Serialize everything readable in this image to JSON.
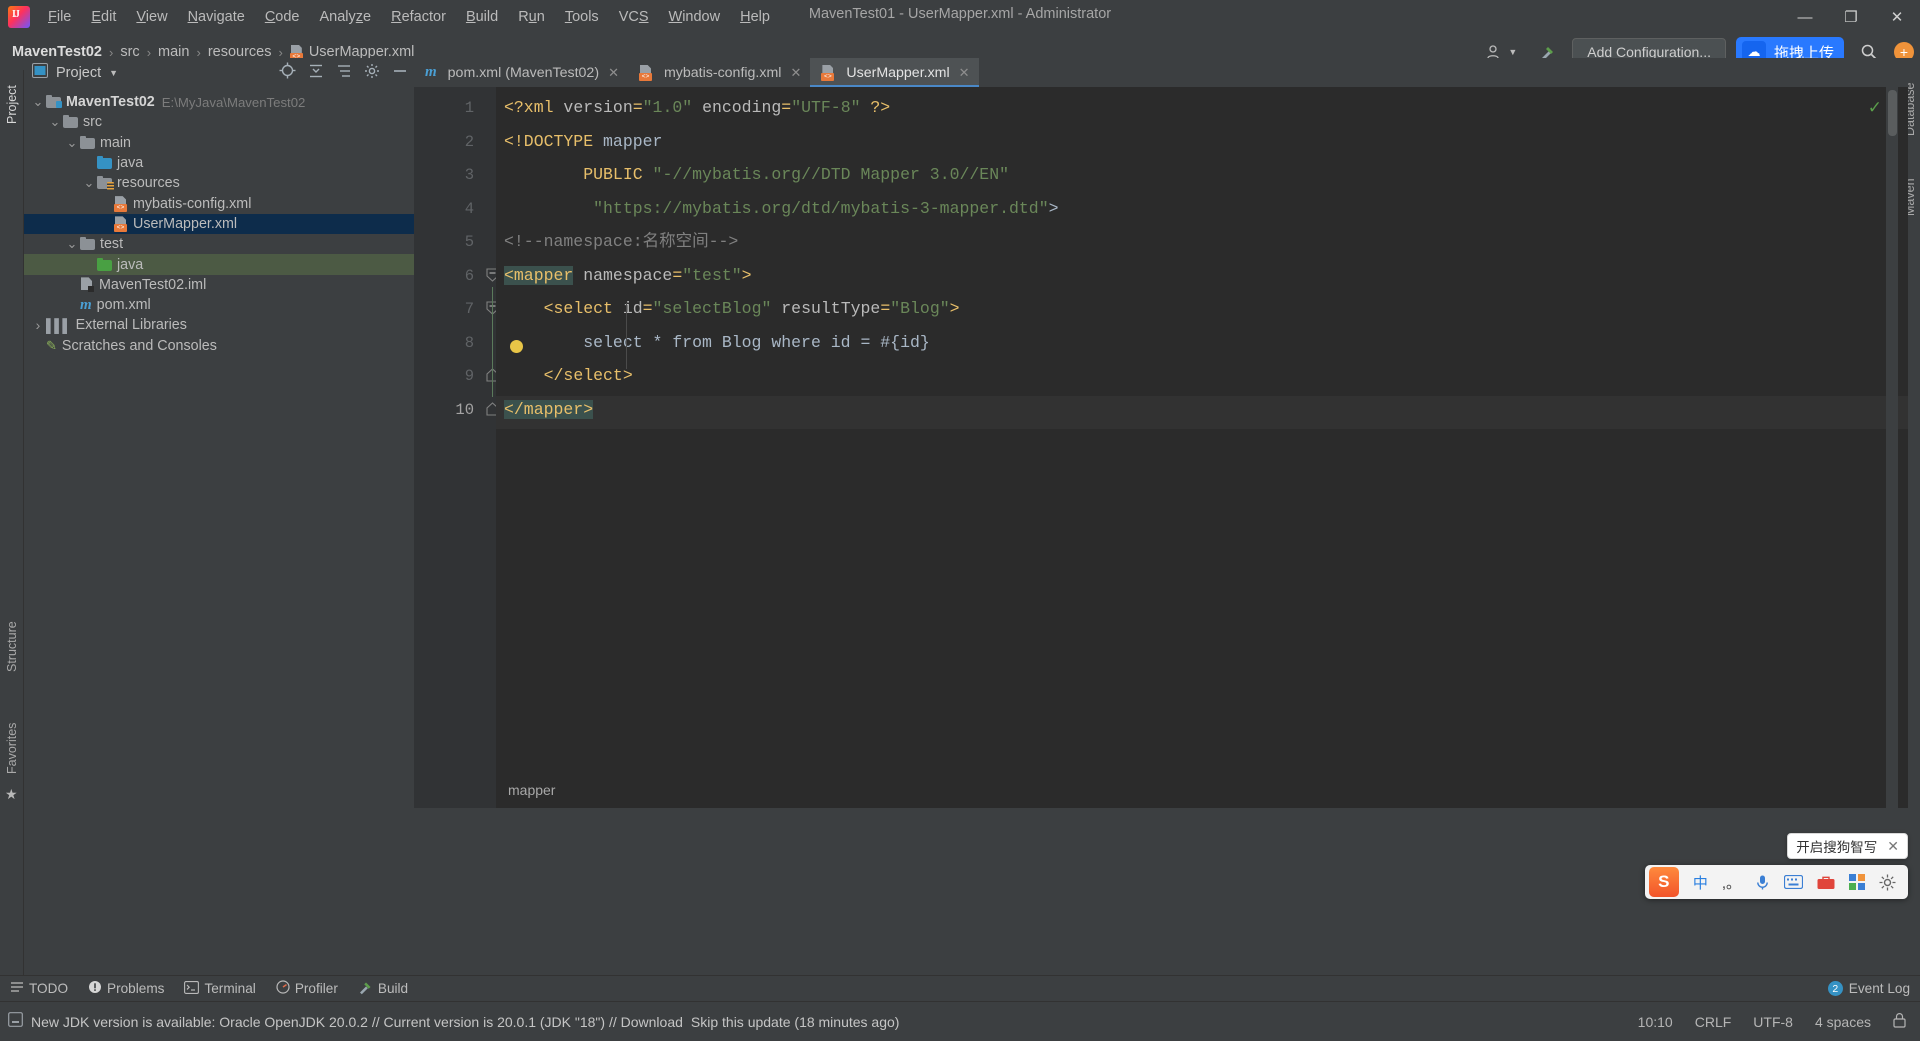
{
  "window": {
    "title": "MavenTest01 - UserMapper.xml - Administrator",
    "minimize": "—",
    "maximize": "❐",
    "close": "✕"
  },
  "menu": {
    "items": [
      {
        "label": "File"
      },
      {
        "label": "Edit"
      },
      {
        "label": "View"
      },
      {
        "label": "Navigate"
      },
      {
        "label": "Code"
      },
      {
        "label": "Analyze"
      },
      {
        "label": "Refactor"
      },
      {
        "label": "Build"
      },
      {
        "label": "Run"
      },
      {
        "label": "Tools"
      },
      {
        "label": "VCS"
      },
      {
        "label": "Window"
      },
      {
        "label": "Help"
      }
    ]
  },
  "breadcrumb": {
    "project": "MavenTest02",
    "parts": [
      "src",
      "main",
      "resources"
    ],
    "file": "UserMapper.xml",
    "separator": "›"
  },
  "navbar_right": {
    "user_icon": "user-icon",
    "hammer_icon": "build-icon",
    "add_configuration": "Add Configuration...",
    "sogou_upload": "拖拽上传",
    "search_icon": "search-icon",
    "plus_icon": "+"
  },
  "left_toolstrip": {
    "project_tab": "Project",
    "structure_tab": "Structure",
    "favorites_tab": "Favorites",
    "star_icon": "★"
  },
  "right_toolstrip": {
    "database_tab": "Database",
    "maven_tab": "Maven"
  },
  "project_panel": {
    "title": "Project",
    "dropdown_icon": "▼",
    "toolbar_icons": [
      "locate-icon",
      "collapse-all-icon",
      "expand-icon",
      "gear-icon",
      "hide-icon"
    ],
    "tree": [
      {
        "label": "MavenTest02",
        "path": "E:\\MyJava\\MavenTest02",
        "indent": 0,
        "arrow": "expanded",
        "icon": "module-folder",
        "bold": true,
        "state": "normal"
      },
      {
        "label": "src",
        "indent": 1,
        "arrow": "expanded",
        "icon": "folder-grey",
        "state": "normal"
      },
      {
        "label": "main",
        "indent": 2,
        "arrow": "expanded",
        "icon": "folder-grey",
        "state": "normal"
      },
      {
        "label": "java",
        "indent": 3,
        "arrow": "none",
        "icon": "folder-blue",
        "state": "normal"
      },
      {
        "label": "resources",
        "indent": 3,
        "arrow": "expanded",
        "icon": "folder-resources",
        "state": "normal"
      },
      {
        "label": "mybatis-config.xml",
        "indent": 4,
        "arrow": "none",
        "icon": "xml-file",
        "state": "normal"
      },
      {
        "label": "UserMapper.xml",
        "indent": 4,
        "arrow": "none",
        "icon": "xml-file",
        "state": "selected"
      },
      {
        "label": "test",
        "indent": 2,
        "arrow": "expanded",
        "icon": "folder-grey",
        "state": "normal"
      },
      {
        "label": "java",
        "indent": 3,
        "arrow": "none",
        "icon": "folder-green",
        "state": "green"
      },
      {
        "label": "MavenTest02.iml",
        "indent": 2,
        "arrow": "none",
        "icon": "iml-file",
        "state": "normal"
      },
      {
        "label": "pom.xml",
        "indent": 2,
        "arrow": "none",
        "icon": "maven-file",
        "state": "normal"
      },
      {
        "label": "External Libraries",
        "indent": 0,
        "arrow": "collapsed",
        "icon": "library-icon",
        "state": "normal"
      },
      {
        "label": "Scratches and Consoles",
        "indent": 0,
        "arrow": "none",
        "icon": "scratch-icon",
        "state": "normal"
      }
    ]
  },
  "editor": {
    "tabs": [
      {
        "label": "pom.xml (MavenTest02)",
        "icon": "maven-file",
        "active": false,
        "close": "✕"
      },
      {
        "label": "mybatis-config.xml",
        "icon": "xml-file",
        "active": false,
        "close": "✕"
      },
      {
        "label": "UserMapper.xml",
        "icon": "xml-file",
        "active": true,
        "close": "✕"
      }
    ],
    "line_numbers": [
      "1",
      "2",
      "3",
      "4",
      "5",
      "6",
      "7",
      "8",
      "9",
      "10"
    ],
    "lines": [
      {
        "n": 1,
        "tokens": [
          {
            "t": "<?xml ",
            "c": "kw-punc"
          },
          {
            "t": "version",
            "c": "kw-attr"
          },
          {
            "t": "=",
            "c": "kw-punc"
          },
          {
            "t": "\"1.0\"",
            "c": "kw-str"
          },
          {
            "t": " ",
            "c": "kw-txt"
          },
          {
            "t": "encoding",
            "c": "kw-attr"
          },
          {
            "t": "=",
            "c": "kw-punc"
          },
          {
            "t": "\"UTF-8\"",
            "c": "kw-str"
          },
          {
            "t": " ",
            "c": "kw-txt"
          },
          {
            "t": "?>",
            "c": "kw-punc"
          }
        ]
      },
      {
        "n": 2,
        "tokens": [
          {
            "t": "<!DOCTYPE",
            "c": "kw-tag"
          },
          {
            "t": " mapper",
            "c": "kw-txt"
          }
        ]
      },
      {
        "n": 3,
        "tokens": [
          {
            "t": "        ",
            "c": "kw-txt"
          },
          {
            "t": "PUBLIC",
            "c": "kw-tag"
          },
          {
            "t": " ",
            "c": "kw-txt"
          },
          {
            "t": "\"-//mybatis.org//DTD Mapper 3.0//EN\"",
            "c": "kw-str"
          }
        ]
      },
      {
        "n": 4,
        "tokens": [
          {
            "t": "         ",
            "c": "kw-txt"
          },
          {
            "t": "\"https://mybatis.org/dtd/mybatis-3-mapper.dtd\"",
            "c": "kw-str"
          },
          {
            "t": ">",
            "c": "kw-txt"
          }
        ]
      },
      {
        "n": 5,
        "tokens": [
          {
            "t": "<!--namespace:名称空间-->",
            "c": "kw-comment"
          }
        ]
      },
      {
        "n": 6,
        "tokens": [
          {
            "t": "<mapper",
            "c": "kw-tag hl-tag"
          },
          {
            "t": " ",
            "c": "kw-txt"
          },
          {
            "t": "namespace",
            "c": "kw-attr"
          },
          {
            "t": "=",
            "c": "kw-punc"
          },
          {
            "t": "\"test\"",
            "c": "kw-str"
          },
          {
            "t": ">",
            "c": "kw-tag"
          }
        ]
      },
      {
        "n": 7,
        "tokens": [
          {
            "t": "    ",
            "c": "kw-txt"
          },
          {
            "t": "<select",
            "c": "kw-tag"
          },
          {
            "t": " ",
            "c": "kw-txt"
          },
          {
            "t": "id",
            "c": "kw-attr"
          },
          {
            "t": "=",
            "c": "kw-punc"
          },
          {
            "t": "\"selectBlog\"",
            "c": "kw-str"
          },
          {
            "t": " ",
            "c": "kw-txt"
          },
          {
            "t": "resultType",
            "c": "kw-attr"
          },
          {
            "t": "=",
            "c": "kw-punc"
          },
          {
            "t": "\"Blog\"",
            "c": "kw-str"
          },
          {
            "t": ">",
            "c": "kw-tag"
          }
        ]
      },
      {
        "n": 8,
        "tokens": [
          {
            "t": "        select * from Blog where id = #{id}",
            "c": "kw-txt"
          }
        ]
      },
      {
        "n": 9,
        "tokens": [
          {
            "t": "    ",
            "c": "kw-txt"
          },
          {
            "t": "</select>",
            "c": "kw-tag"
          }
        ]
      },
      {
        "n": 10,
        "tokens": [
          {
            "t": "</mapper>",
            "c": "kw-tag hl-tag"
          }
        ]
      }
    ],
    "status_breadcrumb": "mapper",
    "inspection_ok": "✓"
  },
  "bottom_toolbar": {
    "items": [
      {
        "label": "TODO",
        "icon": "todo-icon"
      },
      {
        "label": "Problems",
        "icon": "problems-icon"
      },
      {
        "label": "Terminal",
        "icon": "terminal-icon"
      },
      {
        "label": "Profiler",
        "icon": "profiler-icon"
      },
      {
        "label": "Build",
        "icon": "build-icon"
      }
    ],
    "event_log": {
      "label": "Event Log",
      "count": "2"
    }
  },
  "statusbar": {
    "message": "New JDK version is available: Oracle OpenJDK 20.0.2 // Current version is 20.0.1 (JDK \"18\") // Download",
    "skip_link": "Skip this update (18 minutes ago)",
    "position": "10:10",
    "line_sep": "CRLF",
    "encoding": "UTF-8",
    "indent": "4 spaces",
    "lock_icon": "lock-icon"
  },
  "ime": {
    "tip": "开启搜狗智写",
    "tip_close": "✕",
    "logo": "S",
    "mode": "中",
    "comma": ",。",
    "mic_icon": "mic-icon",
    "keyboard_icon": "keyboard-icon",
    "toolbox_icon": "toolbox-icon",
    "grid_icon": "grid-icon",
    "settings_icon": "settings-icon"
  }
}
